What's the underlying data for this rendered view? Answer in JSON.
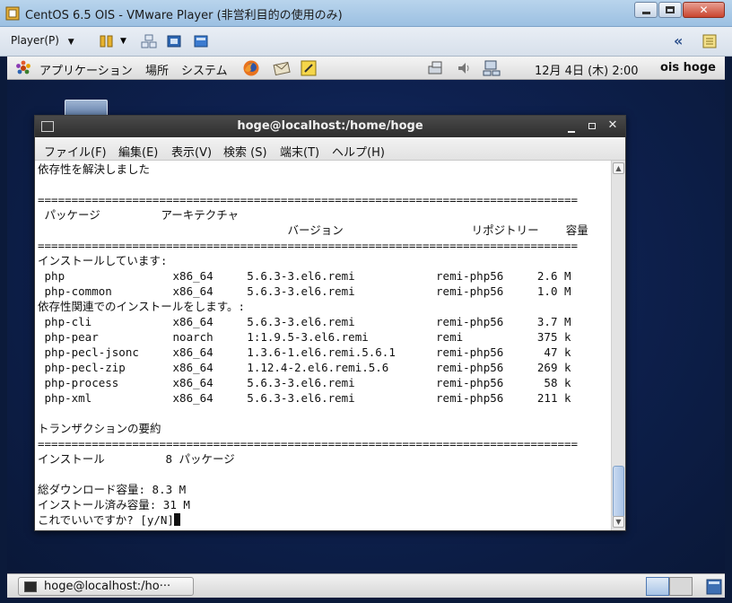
{
  "vm_window": {
    "title": "CentOS 6.5 OIS - VMware Player (非営利目的の使用のみ)",
    "minimize_label": "−",
    "maximize_label": "□",
    "close_label": "✕"
  },
  "vm_toolbar": {
    "player_menu_label": "Player(P)",
    "collapse_label": "«"
  },
  "gnome_top_panel": {
    "menus": [
      "アプリケーション",
      "場所",
      "システム"
    ],
    "clock": "12月 4日 (木)  2:00",
    "user": "ois hoge"
  },
  "terminal": {
    "title": "hoge@localhost:/home/hoge",
    "menus": [
      "ファイル(F)",
      "編集(E)",
      "表示(V)",
      "検索 (S)",
      "端末(T)",
      "ヘルプ(H)"
    ],
    "lines": [
      "依存性を解決しました",
      "",
      "================================================================================",
      " パッケージ         アーキテクチャ",
      "                                     バージョン                   リポジトリー    容量",
      "================================================================================",
      "インストールしています:",
      " php                x86_64     5.6.3-3.el6.remi            remi-php56     2.6 M",
      " php-common         x86_64     5.6.3-3.el6.remi            remi-php56     1.0 M",
      "依存性関連でのインストールをします。:",
      " php-cli            x86_64     5.6.3-3.el6.remi            remi-php56     3.7 M",
      " php-pear           noarch     1:1.9.5-3.el6.remi          remi           375 k",
      " php-pecl-jsonc     x86_64     1.3.6-1.el6.remi.5.6.1      remi-php56      47 k",
      " php-pecl-zip       x86_64     1.12.4-2.el6.remi.5.6       remi-php56     269 k",
      " php-process        x86_64     5.6.3-3.el6.remi            remi-php56      58 k",
      " php-xml            x86_64     5.6.3-3.el6.remi            remi-php56     211 k",
      "",
      "トランザクションの要約",
      "================================================================================",
      "インストール         8 パッケージ",
      "",
      "総ダウンロード容量: 8.3 M",
      "インストール済み容量: 31 M",
      "これでいいですか? [y/N]"
    ]
  },
  "taskbar": {
    "task_label": "hoge@localhost:/ho···"
  },
  "colors": {
    "desktop": "#0e2150",
    "terminal_bg": "#ffffff",
    "terminal_fg": "#111111",
    "titlebar": "#2d2d2d"
  }
}
